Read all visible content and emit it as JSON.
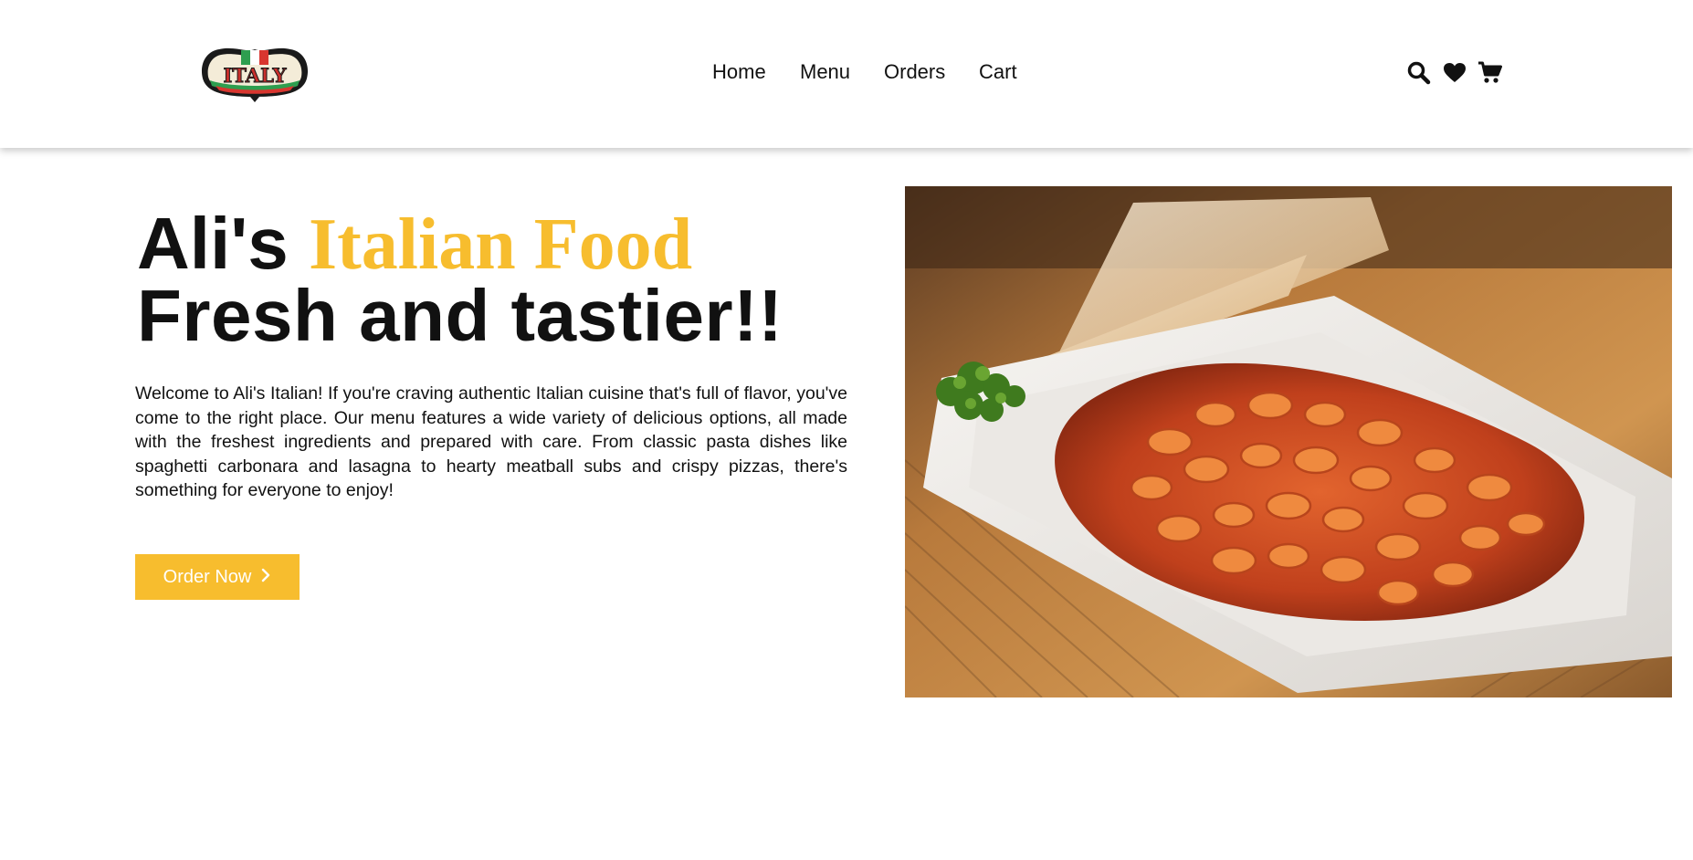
{
  "nav": {
    "logo_text": "ITALY",
    "links": [
      "Home",
      "Menu",
      "Orders",
      "Cart"
    ],
    "icons": [
      "search-icon",
      "heart-icon",
      "cart-icon"
    ]
  },
  "hero": {
    "title_name": "Ali's",
    "title_accent": "Italian Food",
    "title_line2": "Fresh and tastier!!",
    "description": "Welcome to Ali's Italian! If you're craving authentic Italian cuisine that's full of flavor, you've come to the right place. Our menu features a wide variety of delicious options, all made with the freshest ingredients and prepared with care. From classic pasta dishes like spaghetti carbonara and lasagna to hearty meatball subs and crispy pizzas, there's something for everyone to enjoy!",
    "cta_label": "Order Now"
  },
  "colors": {
    "accent": "#f7bd2e",
    "text": "#111111",
    "background": "#ffffff"
  }
}
